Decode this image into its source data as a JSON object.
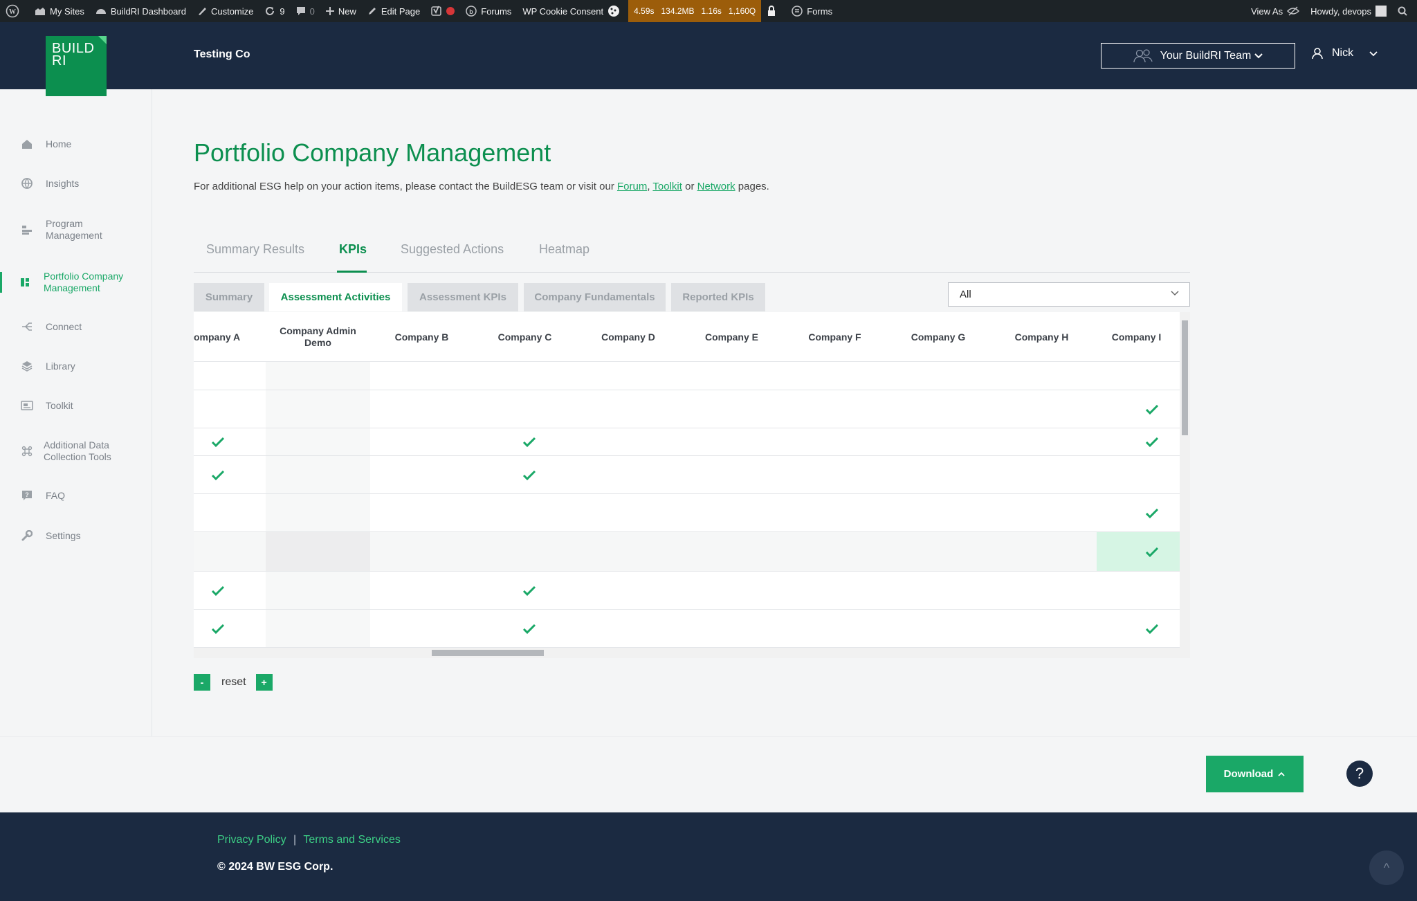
{
  "admin_bar": {
    "my_sites": "My Sites",
    "dashboard": "BuildRI Dashboard",
    "customize": "Customize",
    "updates_count": "9",
    "comments_count": "0",
    "new": "New",
    "edit_page": "Edit Page",
    "forums": "Forums",
    "cookie_consent": "WP Cookie Consent",
    "perf_time": "4.59s",
    "perf_memory": "134.2MB",
    "perf_db_time": "1.16s",
    "perf_queries": "1,160Q",
    "forms": "Forms",
    "view_as": "View As",
    "howdy": "Howdy, devops"
  },
  "header": {
    "logo_line1": "BUILD",
    "logo_line2": "RI",
    "company": "Testing Co",
    "team_button": "Your BuildRI Team",
    "user_name": "Nick"
  },
  "sidebar": {
    "items": [
      {
        "label": "Home",
        "icon": "home-icon"
      },
      {
        "label": "Insights",
        "icon": "globe-icon"
      },
      {
        "label": "Program Management",
        "icon": "program-icon"
      },
      {
        "label": "Portfolio Company Management",
        "icon": "grid-icon",
        "active": true
      },
      {
        "label": "Connect",
        "icon": "connect-icon"
      },
      {
        "label": "Library",
        "icon": "layers-icon"
      },
      {
        "label": "Toolkit",
        "icon": "toolkit-icon"
      },
      {
        "label": "Additional Data Collection Tools",
        "icon": "command-icon"
      },
      {
        "label": "FAQ",
        "icon": "faq-icon"
      },
      {
        "label": "Settings",
        "icon": "wrench-icon"
      }
    ]
  },
  "main": {
    "title": "Portfolio Company Management",
    "help_prefix": "For additional ESG help on your action items, please contact the BuildESG team or visit our ",
    "help_link_forum": "Forum",
    "help_sep1": ", ",
    "help_link_toolkit": "Toolkit",
    "help_sep2": " or ",
    "help_link_network": "Network",
    "help_suffix": " pages.",
    "tabs": [
      {
        "label": "Summary Results"
      },
      {
        "label": "KPIs",
        "active": true
      },
      {
        "label": "Suggested Actions"
      },
      {
        "label": "Heatmap"
      }
    ],
    "subtabs": [
      {
        "label": "Summary"
      },
      {
        "label": "Assessment Activities",
        "active": true
      },
      {
        "label": "Assessment KPIs"
      },
      {
        "label": "Company Fundamentals"
      },
      {
        "label": "Reported KPIs"
      }
    ],
    "filter_value": "All"
  },
  "table": {
    "columns": [
      "ompany A",
      "Company Admin Demo",
      "Company B",
      "Company C",
      "Company D",
      "Company E",
      "Company F",
      "Company G",
      "Company H",
      "Company I"
    ],
    "rows": [
      {
        "checks": []
      },
      {
        "checks": [
          9
        ]
      },
      {
        "checks": [
          0,
          3,
          9
        ]
      },
      {
        "checks": [
          0,
          3
        ]
      },
      {
        "checks": [
          9
        ]
      },
      {
        "checks": [
          9
        ],
        "highlight": true
      },
      {
        "checks": [
          0,
          3
        ]
      },
      {
        "checks": [
          0,
          3,
          9
        ]
      }
    ]
  },
  "zoom": {
    "minus": "-",
    "reset": "reset",
    "plus": "+"
  },
  "actions": {
    "download": "Download",
    "help": "?"
  },
  "footer": {
    "privacy": "Privacy Policy",
    "separator": "|",
    "terms": "Terms and Services",
    "copyright": "© 2024 BW ESG Corp.",
    "back_to_top": "^"
  },
  "colors": {
    "brand_green": "#0c8f4f",
    "accent_green": "#1aa867",
    "navy": "#1b2a41",
    "admin_bar": "#1d2327",
    "perf_orange": "#9c5d0a"
  }
}
